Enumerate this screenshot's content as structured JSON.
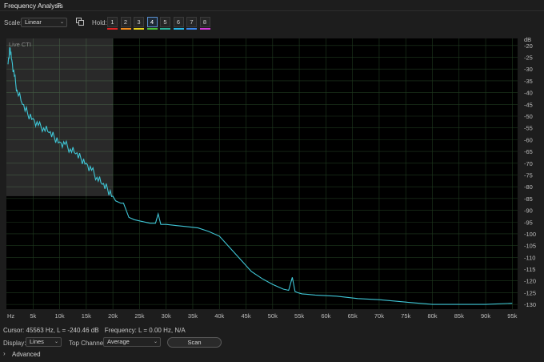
{
  "panel": {
    "title": "Frequency Analysis",
    "menu_icon": "≡"
  },
  "toolbar": {
    "scale_label": "Scale:",
    "scale_value": "Linear",
    "hold_label": "Hold:",
    "hold_buttons": [
      {
        "label": "1",
        "color": "#e02424"
      },
      {
        "label": "2",
        "color": "#f08a1c"
      },
      {
        "label": "3",
        "color": "#e8d21c"
      },
      {
        "label": "4",
        "color": "#49c23a"
      },
      {
        "label": "5",
        "color": "#2bb39b"
      },
      {
        "label": "6",
        "color": "#27b8e6"
      },
      {
        "label": "7",
        "color": "#3c86e8"
      },
      {
        "label": "8",
        "color": "#d43ad8"
      }
    ],
    "hold_active": 4,
    "copy_icon": "copy-icon"
  },
  "chart_data": {
    "type": "line",
    "overlay_label": "Live CTI",
    "xlabel_unit": "Hz",
    "ylabel_unit": "dB",
    "xlim": [
      0,
      96000
    ],
    "ylim": [
      -132,
      -17
    ],
    "x_ticks": [
      "Hz",
      "5k",
      "10k",
      "15k",
      "20k",
      "25k",
      "30k",
      "35k",
      "40k",
      "45k",
      "50k",
      "55k",
      "60k",
      "65k",
      "70k",
      "75k",
      "80k",
      "85k",
      "90k",
      "95k"
    ],
    "y_ticks": [
      "dB",
      "-20",
      "-25",
      "-30",
      "-35",
      "-40",
      "-45",
      "-50",
      "-55",
      "-60",
      "-65",
      "-70",
      "-75",
      "-80",
      "-85",
      "-90",
      "-95",
      "-100",
      "-105",
      "-110",
      "-115",
      "-120",
      "-125",
      "-130"
    ],
    "grid": true,
    "line_color": "#3fc6d6",
    "overlay_x_range": [
      0,
      20000
    ],
    "overlay_y_floor": -84,
    "series": [
      {
        "x": [
          300,
          700,
          1000,
          1500,
          2000,
          3000,
          4000,
          5000,
          6000,
          7000,
          8000,
          9000,
          10000,
          11000,
          12000,
          13000,
          14000,
          15000,
          16000,
          17000,
          18000,
          19000,
          20000,
          20500,
          21000,
          21500,
          22000,
          23000,
          24000,
          25000,
          26000,
          27000,
          28000,
          28500,
          29000,
          29500,
          30000,
          32000,
          34000,
          36000,
          38000,
          40000,
          42000,
          44000,
          46000,
          48000,
          50000,
          52000,
          53000,
          53700,
          54200,
          54700,
          55500,
          58000,
          62000,
          66000,
          70000,
          75000,
          80000,
          85000,
          90000,
          95000
        ],
        "y": [
          -28,
          -21,
          -26,
          -33,
          -39,
          -45,
          -49,
          -51,
          -54,
          -55,
          -57,
          -59,
          -61,
          -62,
          -64,
          -66,
          -68,
          -70,
          -73,
          -76,
          -79,
          -81,
          -84,
          -86,
          -86.5,
          -87,
          -87,
          -93,
          -94,
          -94.5,
          -95,
          -95.5,
          -95.5,
          -91.5,
          -96,
          -96,
          -96,
          -96.5,
          -97,
          -97.5,
          -99,
          -101,
          -106,
          -111,
          -116,
          -119,
          -121.5,
          -123.5,
          -124,
          -118.5,
          -124.5,
          -125,
          -125.5,
          -126,
          -126.5,
          -127.5,
          -128,
          -129,
          -130,
          -130,
          -130,
          -129.5
        ]
      }
    ]
  },
  "status": {
    "cursor_text": "Cursor: 45563 Hz, L = -240.46 dB",
    "frequency_text": "Frequency: L = 0.00 Hz, N/A"
  },
  "bottom": {
    "display_label": "Display:",
    "display_value": "Lines",
    "top_channel_label": "Top Channel:",
    "top_channel_value": "Average",
    "scan_label": "Scan",
    "advanced_label": "Advanced",
    "advanced_chevron": "›"
  }
}
